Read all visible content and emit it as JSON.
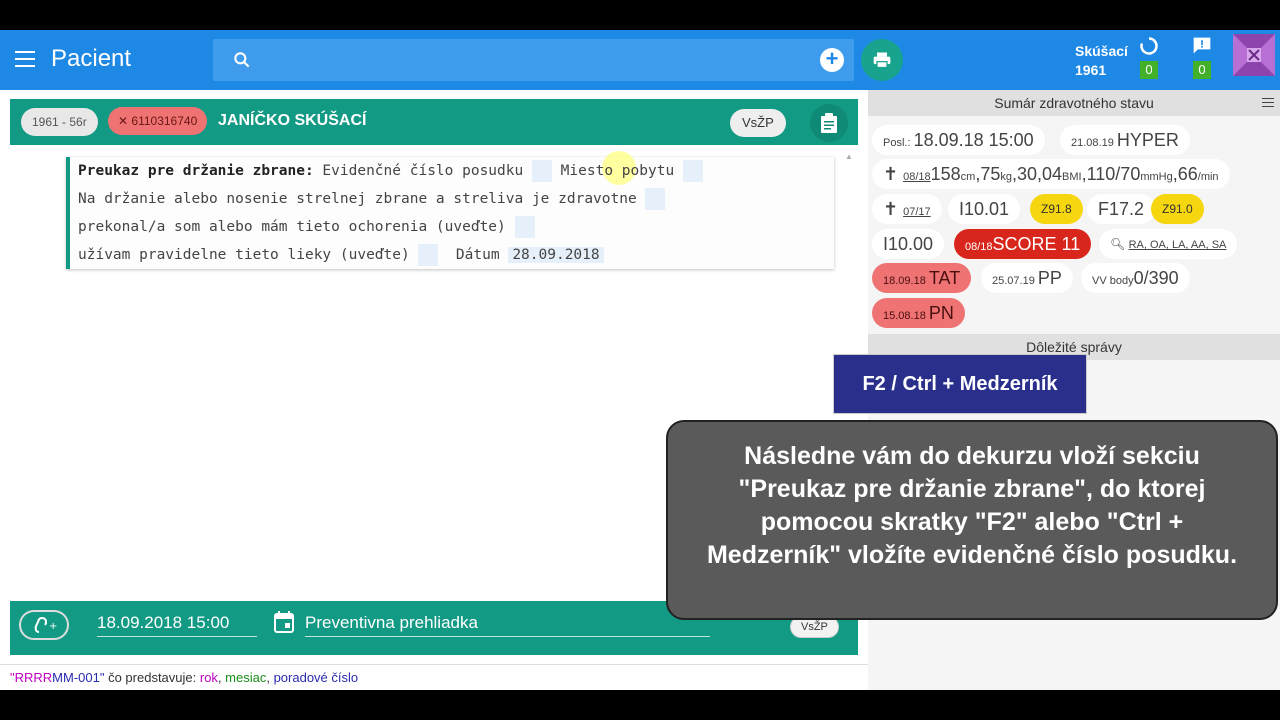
{
  "app": {
    "title": "Pacient"
  },
  "search": {
    "placeholder": ""
  },
  "user": {
    "name": "Skúšací",
    "year": "1961",
    "sync_count": "0",
    "msg_count": "0"
  },
  "patient": {
    "year_chip": "1961 - 56r",
    "id_chip": "6110316740",
    "name": "JANÍČKO SKÚŠACÍ",
    "insurer": "VsŽP"
  },
  "editor": {
    "line1_label": "Preukaz pre držanie zbrane:",
    "line1_text": " Evidenčné číslo posudku ",
    "line1_text2": " Miesto pobytu ",
    "line2": "Na držanie alebo nosenie strelnej zbrane a streliva je zdravotne ",
    "line3": "prekonal/a som alebo mám tieto ochorenia (uveďte) ",
    "line4": "užívam pravidelne tieto lieky (uveďte) ",
    "line4_date_label": "  Dátum ",
    "line4_date": "28.09.2018"
  },
  "bottom_bar": {
    "date": "18.09.2018 15:00",
    "visit_type": "Preventivna prehliadka",
    "insurer": "VsŽP"
  },
  "footer": {
    "q1": "\"RRRR",
    "mm": "MM-001\"",
    "text": " čo predstavuje: ",
    "rok": "rok",
    "sep": ", ",
    "mesiac": "mesiac",
    "comma": ", ",
    "poradove": "poradové číslo"
  },
  "summary": {
    "title": "Sumár zdravotného stavu",
    "posl_label": "Posl.: ",
    "posl_value": "18.09.18 15:00",
    "hyper_date": "21.08.19 ",
    "hyper": "HYPER",
    "vitals_date": "08/18",
    "vitals_cm": "158",
    "vitals_cm_unit": "cm",
    "vitals_kg": ",75",
    "vitals_kg_unit": "kg",
    "vitals_bmi": ",30,04",
    "vitals_bmi_unit": "BMI",
    "vitals_bp": ",110/70",
    "vitals_bp_unit": "mmHg",
    "vitals_hr": ",66",
    "vitals_hr_unit": "/min",
    "dx_date": "07/17",
    "dx1": "I10.01",
    "dx2": "Z91.8",
    "dx3": "F17.2",
    "dx4": "Z91.0",
    "dx5": "I10.00",
    "score_date": "08/18",
    "score": "SCORE 11",
    "allergy": "RA, OA, LA, AA, SA",
    "tat_date": "18.09.18 ",
    "tat": "TAT",
    "pp_date": "25.07.19 ",
    "pp": "PP",
    "vv_label": "VV body",
    "vv_value": "0/390",
    "pn_date": "15.08.18 ",
    "pn": "PN"
  },
  "messages": {
    "title": "Dôležité správy"
  },
  "hint": {
    "shortcut": "F2 / Ctrl + Medzerník"
  },
  "tooltip": {
    "text": "Následne vám do dekurzu vloží sekciu \"Preukaz pre držanie zbrane\", do ktorej pomocou skratky \"F2\" alebo \"Ctrl + Medzerník\" vložíte evidenčné číslo posudku."
  },
  "colors": {
    "appbar": "#1e88e5",
    "teal": "#139a85",
    "score_red": "#d9261c",
    "yellow": "#f5d60f",
    "pink": "#ef7373"
  }
}
